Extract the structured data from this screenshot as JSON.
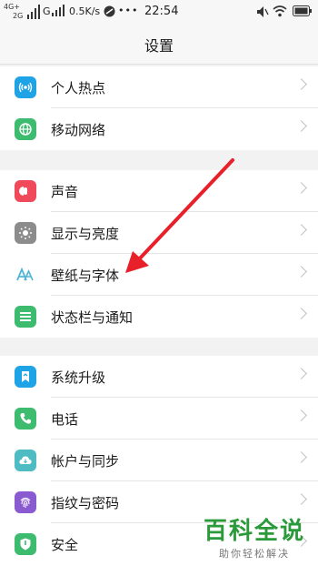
{
  "status_bar": {
    "net_4g": "4G+",
    "net_2g": "2G",
    "net_g": "G",
    "speed": "0.5K/s",
    "time": "22:54",
    "more": "•••"
  },
  "header": {
    "title": "设置"
  },
  "groups": [
    {
      "items": [
        {
          "label": "个人热点",
          "icon": "hotspot-icon",
          "color": "#1ea3e6"
        },
        {
          "label": "移动网络",
          "icon": "globe-icon",
          "color": "#3dbb6f"
        }
      ]
    },
    {
      "items": [
        {
          "label": "声音",
          "icon": "volume-icon",
          "color": "#f04a5a"
        },
        {
          "label": "显示与亮度",
          "icon": "brightness-icon",
          "color": "#8c8c8c"
        },
        {
          "label": "壁纸与字体",
          "icon": "font-icon",
          "color": "#4fb6d6"
        },
        {
          "label": "状态栏与通知",
          "icon": "list-icon",
          "color": "#3dbb6f"
        }
      ]
    },
    {
      "items": [
        {
          "label": "系统升级",
          "icon": "upgrade-icon",
          "color": "#1ea3e6"
        },
        {
          "label": "电话",
          "icon": "phone-icon",
          "color": "#3dbb6f"
        },
        {
          "label": "帐户与同步",
          "icon": "cloud-icon",
          "color": "#4fbcc4"
        },
        {
          "label": "指纹与密码",
          "icon": "fingerprint-icon",
          "color": "#8a5ad0"
        },
        {
          "label": "安全",
          "icon": "shield-icon",
          "color": "#3dbb6f"
        }
      ]
    }
  ],
  "watermark": {
    "title": "百科全说",
    "subtitle": "助你轻松解决"
  },
  "annotation": {
    "arrow_color": "#e8202a"
  }
}
